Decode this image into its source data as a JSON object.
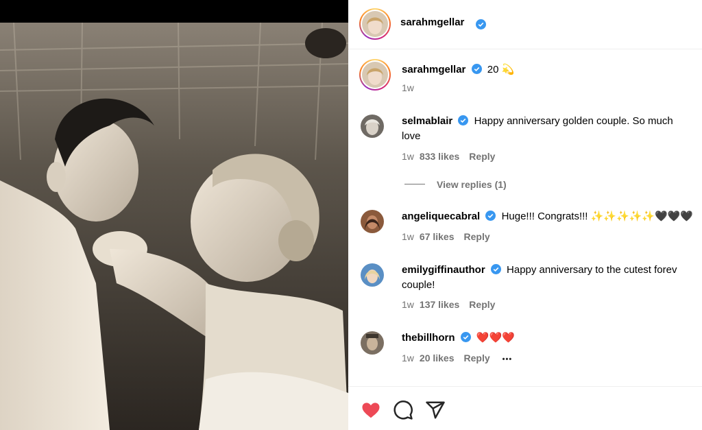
{
  "post": {
    "author": "sarahmgellar",
    "caption_text": "20",
    "caption_emoji": "💫",
    "caption_time": "1w"
  },
  "comments": [
    {
      "user": "selmablair",
      "text_line1": "Happy anniversary golden couple. So much",
      "text_line2": "love",
      "time": "1w",
      "likes": "833 likes",
      "reply": "Reply",
      "view_replies": "View replies (1)"
    },
    {
      "user": "angeliquecabral",
      "text_line1": "Huge!!! Congrats!!! ✨✨✨✨✨🖤🖤🖤",
      "time": "1w",
      "likes": "67 likes",
      "reply": "Reply"
    },
    {
      "user": "emilygiffinauthor",
      "text_line1": "Happy anniversary to the cutest forev",
      "text_line2": "couple!",
      "time": "1w",
      "likes": "137 likes",
      "reply": "Reply"
    },
    {
      "user": "thebillhorn",
      "text_line1": "❤️❤️❤️",
      "time": "1w",
      "likes": "20 likes",
      "reply": "Reply",
      "more": "•••"
    }
  ],
  "actions": {
    "like_icon": "heart-filled-icon",
    "comment_icon": "comment-icon",
    "share_icon": "share-icon"
  },
  "colors": {
    "like_red": "#ed4956",
    "verified_blue": "#3897f0",
    "meta_gray": "#737373"
  }
}
